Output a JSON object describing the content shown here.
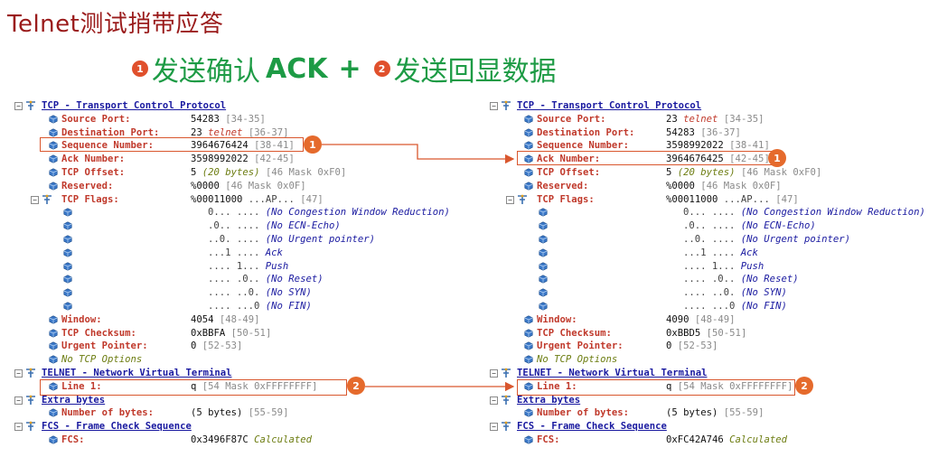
{
  "slide_title": "Telnet测试捎带应答",
  "subtitle": {
    "badge1": "1",
    "part1": "发送确认",
    "ack": "ACK",
    "plus": "+",
    "badge2": "2",
    "part2": "发送回显数据"
  },
  "markers": {
    "one": "1",
    "two": "2"
  },
  "colors": {
    "title_red": "#9a1b1b",
    "subtitle_green": "#1d9b45",
    "highlight_orange": "#e56a2c",
    "field_label_blue": "#1a1aa0"
  },
  "left": {
    "tcp_title": "TCP - Transport Control Protocol",
    "src_label": "Source Port:",
    "src_val": "54283",
    "src_rng": "[34-35]",
    "dst_label": "Destination Port:",
    "dst_val": "23",
    "dst_note": "telnet",
    "dst_rng": "[36-37]",
    "seq_label": "Sequence Number:",
    "seq_val": "3964676424",
    "seq_rng": "[38-41]",
    "ack_label": "Ack Number:",
    "ack_val": "3598992022",
    "ack_rng": "[42-45]",
    "off_label": "TCP Offset:",
    "off_val": "5",
    "off_note": "(20 bytes)",
    "off_rng": "[46 Mask 0xF0]",
    "res_label": "Reserved:",
    "res_val": "%0000",
    "res_rng": "[46 Mask 0x0F]",
    "flags_label": "TCP Flags:",
    "flags_val": "%00011000",
    "flags_note": "...AP...",
    "flags_rng": "[47]",
    "flag_bits": [
      {
        "bits": "0... ....",
        "desc": "(No Congestion Window Reduction)"
      },
      {
        "bits": ".0.. ....",
        "desc": "(No ECN-Echo)"
      },
      {
        "bits": "..0. ....",
        "desc": "(No Urgent pointer)"
      },
      {
        "bits": "...1 ....",
        "desc": "Ack"
      },
      {
        "bits": ".... 1...",
        "desc": "Push"
      },
      {
        "bits": ".... .0..",
        "desc": "(No Reset)"
      },
      {
        "bits": ".... ..0.",
        "desc": "(No SYN)"
      },
      {
        "bits": ".... ...0",
        "desc": "(No FIN)"
      }
    ],
    "win_label": "Window:",
    "win_val": "4054",
    "win_rng": "[48-49]",
    "chk_label": "TCP Checksum:",
    "chk_val": "0xBBFA",
    "chk_rng": "[50-51]",
    "urg_label": "Urgent Pointer:",
    "urg_val": "0",
    "urg_rng": "[52-53]",
    "noopt": "No TCP Options",
    "telnet_title": "TELNET - Network Virtual Terminal",
    "line_label": "Line  1:",
    "line_val": "q",
    "line_rng": "[54 Mask 0xFFFFFFFF]",
    "extra_title": "Extra bytes",
    "nbytes_label": "Number of bytes:",
    "nbytes_val": "(5 bytes)",
    "nbytes_rng": "[55-59]",
    "fcs_title": "FCS - Frame Check Sequence",
    "fcs_label": "FCS:",
    "fcs_val": "0x3496F87C",
    "fcs_note": "Calculated"
  },
  "right": {
    "tcp_title": "TCP - Transport Control Protocol",
    "src_label": "Source Port:",
    "src_val": "23",
    "src_note": "telnet",
    "src_rng": "[34-35]",
    "dst_label": "Destination Port:",
    "dst_val": "54283",
    "dst_rng": "[36-37]",
    "seq_label": "Sequence Number:",
    "seq_val": "3598992022",
    "seq_rng": "[38-41]",
    "ack_label": "Ack Number:",
    "ack_val": "3964676425",
    "ack_rng": "[42-45]",
    "off_label": "TCP Offset:",
    "off_val": "5",
    "off_note": "(20 bytes)",
    "off_rng": "[46 Mask 0xF0]",
    "res_label": "Reserved:",
    "res_val": "%0000",
    "res_rng": "[46 Mask 0x0F]",
    "flags_label": "TCP Flags:",
    "flags_val": "%00011000",
    "flags_note": "...AP...",
    "flags_rng": "[47]",
    "flag_bits": [
      {
        "bits": "0... ....",
        "desc": "(No Congestion Window Reduction)"
      },
      {
        "bits": ".0.. ....",
        "desc": "(No ECN-Echo)"
      },
      {
        "bits": "..0. ....",
        "desc": "(No Urgent pointer)"
      },
      {
        "bits": "...1 ....",
        "desc": "Ack"
      },
      {
        "bits": ".... 1...",
        "desc": "Push"
      },
      {
        "bits": ".... .0..",
        "desc": "(No Reset)"
      },
      {
        "bits": ".... ..0.",
        "desc": "(No SYN)"
      },
      {
        "bits": ".... ...0",
        "desc": "(No FIN)"
      }
    ],
    "win_label": "Window:",
    "win_val": "4090",
    "win_rng": "[48-49]",
    "chk_label": "TCP Checksum:",
    "chk_val": "0xBBD5",
    "chk_rng": "[50-51]",
    "urg_label": "Urgent Pointer:",
    "urg_val": "0",
    "urg_rng": "[52-53]",
    "noopt": "No TCP Options",
    "telnet_title": "TELNET - Network Virtual Terminal",
    "line_label": "Line  1:",
    "line_val": "q",
    "line_rng": "[54 Mask 0xFFFFFFFF]",
    "extra_title": "Extra bytes",
    "nbytes_label": "Number of bytes:",
    "nbytes_val": "(5 bytes)",
    "nbytes_rng": "[55-59]",
    "fcs_title": "FCS - Frame Check Sequence",
    "fcs_label": "FCS:",
    "fcs_val": "0xFC42A746",
    "fcs_note": "Calculated"
  }
}
